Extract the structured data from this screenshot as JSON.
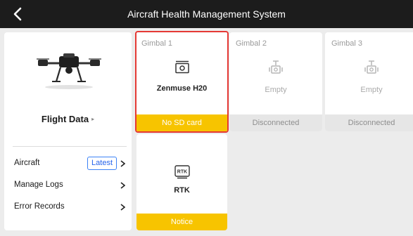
{
  "header": {
    "title": "Aircraft Health Management System",
    "back_icon": "chevron-left-icon"
  },
  "left_panel": {
    "flight_data_label": "Flight Data",
    "flight_data_arrow": "▸",
    "menu": [
      {
        "label": "Aircraft",
        "badge": "Latest",
        "icon": "chevron-right-icon"
      },
      {
        "label": "Manage Logs",
        "icon": "chevron-right-icon"
      },
      {
        "label": "Error Records",
        "icon": "chevron-right-icon"
      }
    ]
  },
  "cards": [
    {
      "caption": "Gimbal 1",
      "name": "Zenmuse H20",
      "status": "No SD card",
      "status_kind": "warning",
      "icon": "camera-icon",
      "selected": true
    },
    {
      "caption": "Gimbal 2",
      "name": "Empty",
      "status": "Disconnected",
      "status_kind": "disconnected",
      "icon": "gimbal-mount-icon"
    },
    {
      "caption": "Gimbal 3",
      "name": "Empty",
      "status": "Disconnected",
      "status_kind": "disconnected",
      "icon": "gimbal-mount-icon"
    },
    {
      "caption": "",
      "name": "RTK",
      "status": "Notice",
      "status_kind": "warning",
      "icon": "rtk-icon",
      "icon_text": "RTK"
    }
  ],
  "colors": {
    "warning": "#f7c400",
    "selected_border": "#e53935",
    "badge": "#2563eb",
    "topbar": "#1c1c1c"
  }
}
